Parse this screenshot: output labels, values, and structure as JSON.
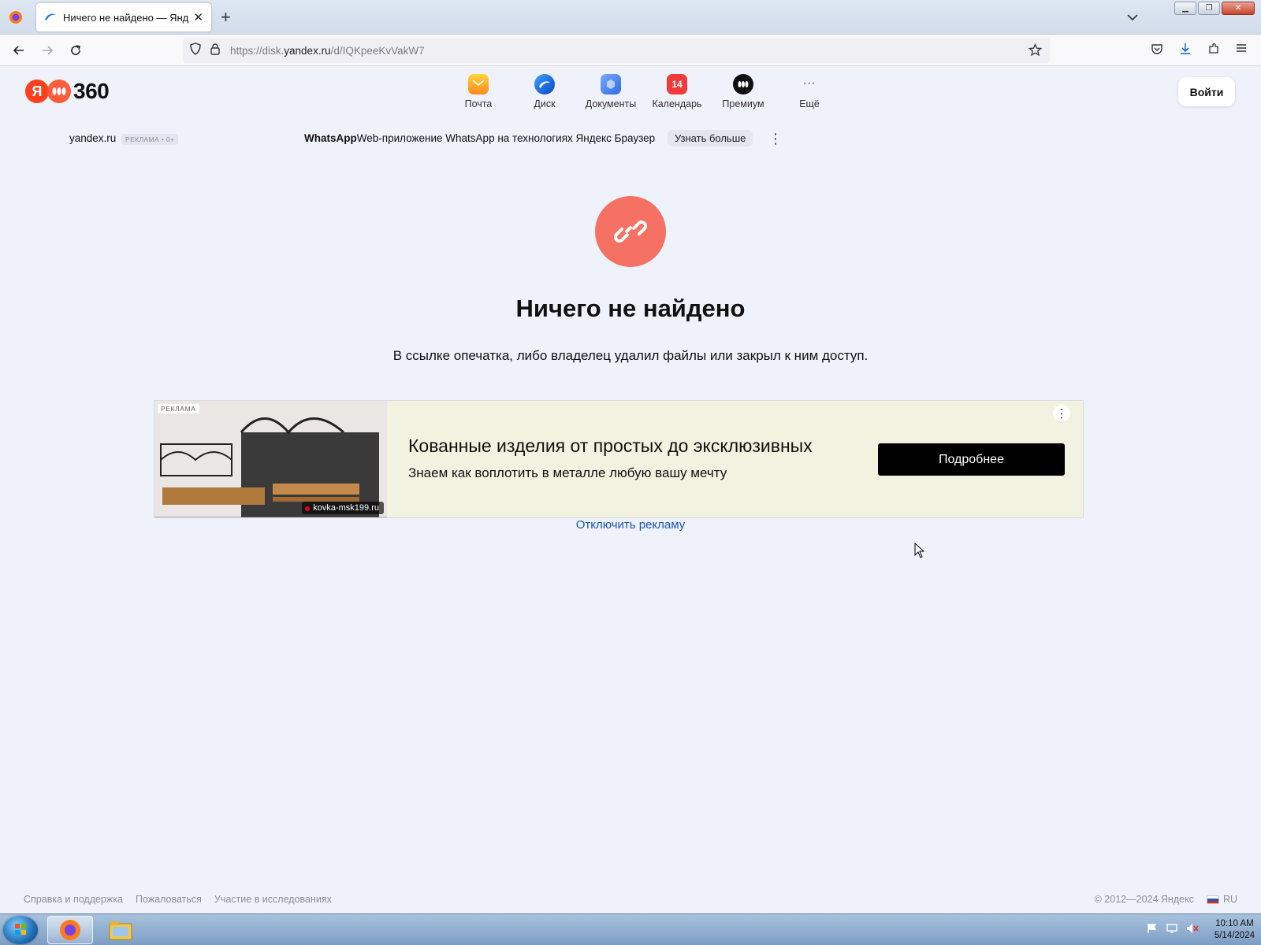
{
  "browser": {
    "tab_title": "Ничего не найдено — Яндекс",
    "new_tab": "+",
    "url_prefix": "https://disk.",
    "url_domain": "yandex.ru",
    "url_path": "/d/IQKpeeKvVakW7"
  },
  "header": {
    "logo_number": "360",
    "services": [
      {
        "label": "Почта",
        "icon": "mail-icon",
        "color": "#ffb21e"
      },
      {
        "label": "Диск",
        "icon": "disk-icon",
        "color": "#1565e0"
      },
      {
        "label": "Документы",
        "icon": "documents-icon",
        "color": "#4f86f7"
      },
      {
        "label": "Календарь",
        "icon": "calendar-icon",
        "color": "#f23a3a",
        "badge": "14"
      },
      {
        "label": "Премиум",
        "icon": "premium-icon",
        "color": "#111111"
      },
      {
        "label": "Ещё",
        "icon": "more-icon",
        "color": "#9a9ca8"
      }
    ],
    "login_label": "Войти"
  },
  "top_ad": {
    "domain": "yandex.ru",
    "badge": "РЕКЛАМА • 0+",
    "brand": "WhatsApp",
    "text": "Web-приложение WhatsApp на технологиях Яндекс Браузера. С",
    "more_label": "Узнать больше"
  },
  "main": {
    "title": "Ничего не найдено",
    "description": "В ссылке опечатка, либо владелец удалил файлы или закрыл к ним доступ."
  },
  "banner": {
    "tag": "РЕКЛАМА",
    "site": "kovka-msk199.ru",
    "headline": "Кованные изделия от простых до эксклюзивных",
    "subtitle": "Знаем как воплотить в металле любую вашу мечту",
    "cta": "Подробнее"
  },
  "disable_ads": "Отключить рекламу",
  "footer": {
    "links": [
      "Справка и поддержка",
      "Пожаловаться",
      "Участие в исследованиях"
    ],
    "copyright": "© 2012—2024 Яндекс",
    "lang": "RU"
  },
  "taskbar": {
    "time": "10:10 AM",
    "date": "5/14/2024"
  },
  "colors": {
    "page_bg": "#eff1fb",
    "error_icon": "#f47163",
    "link": "#1a57b6",
    "cta_bg": "#000000"
  }
}
